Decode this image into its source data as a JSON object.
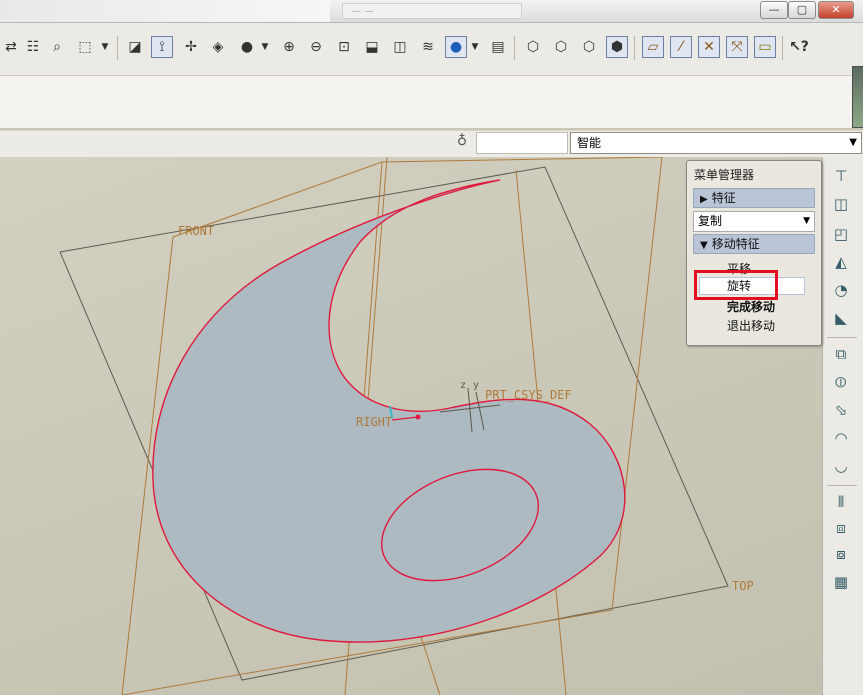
{
  "window": {
    "address_text": "— —",
    "minimize": "—",
    "maximize": "▢",
    "close": "✕"
  },
  "toolbar": {
    "icons": [
      "regen-icon",
      "regen-manager-icon",
      "find-icon",
      "select-box-icon",
      "dropdown-icon",
      "sketch-view-icon",
      "datum-axis-icon",
      "spin-center-icon",
      "shading-icon",
      "appearance-icon",
      "zoom-in-icon",
      "zoom-out-icon",
      "refit-icon",
      "orient-icon",
      "saved-views-icon",
      "layers-icon",
      "view-manager-icon",
      "display-style-icon",
      "wireframe-icon",
      "hidden-line-icon",
      "no-hidden-icon",
      "shaded-icon",
      "datum-planes-icon",
      "datum-axes-icon",
      "datum-points-icon",
      "csys-icon",
      "annotation-icon",
      "whats-this-icon"
    ]
  },
  "filter": {
    "value": "智能"
  },
  "menu_manager": {
    "title": "菜单管理器",
    "section_feature": "特征",
    "copy_option": "复制",
    "section_move": "移动特征",
    "items": {
      "translate": "平移",
      "rotate": "旋转",
      "done_move": "完成移动",
      "quit_move": "退出移动"
    }
  },
  "model": {
    "front_label": "FRONT",
    "right_label": "RIGHT",
    "top_label": "TOP",
    "csys_label": "PRT_CSYS_DEF",
    "axis_z": "z",
    "axis_y": "y"
  },
  "colors": {
    "curve": "#e0193c",
    "fill": "#aebac2",
    "datum": "#b07a3a",
    "highlight": "#e10f1f"
  }
}
